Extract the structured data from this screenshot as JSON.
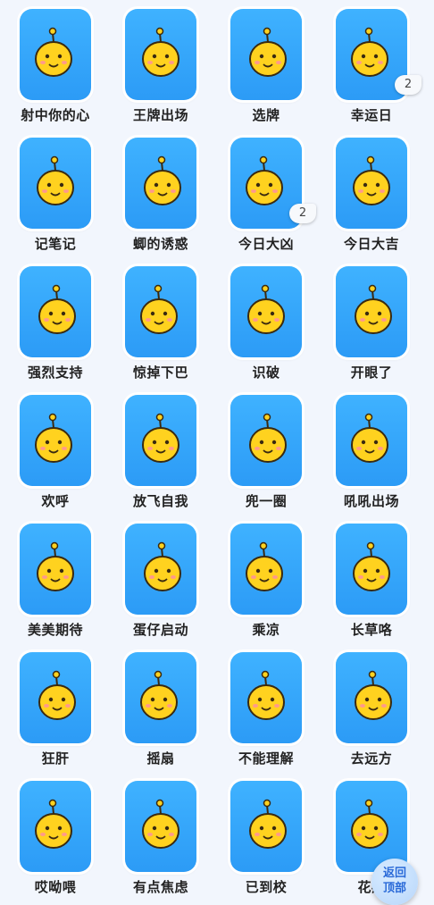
{
  "colors": {
    "card": "#2c9bf6",
    "label": "#222222",
    "face": "#ffd21f",
    "background": "#f2f6fd"
  },
  "stickers": [
    {
      "label": "射中你的心",
      "icon": "bow-heart-icon"
    },
    {
      "label": "王牌出场",
      "icon": "ace-card-icon"
    },
    {
      "label": "选牌",
      "icon": "cards-icon"
    },
    {
      "label": "幸运日",
      "icon": "clover-icon",
      "badge": "2"
    },
    {
      "label": "记笔记",
      "icon": "notebook-icon"
    },
    {
      "label": "蝍的诱惑",
      "icon": "bee-costume-icon"
    },
    {
      "label": "今日大凶",
      "icon": "fortune-slip-icon",
      "badge": "2"
    },
    {
      "label": "今日大吉",
      "icon": "fortune-slip-icon"
    },
    {
      "label": "强烈支持",
      "icon": "pink-cloud-icon"
    },
    {
      "label": "惊掉下巴",
      "icon": "shocked-costume-icon"
    },
    {
      "label": "识破",
      "icon": "detective-icon"
    },
    {
      "label": "开眼了",
      "icon": "glasses-icon"
    },
    {
      "label": "欢呼",
      "icon": "cheer-icon"
    },
    {
      "label": "放飞自我",
      "icon": "kite-icon"
    },
    {
      "label": "兜一圈",
      "icon": "net-icon"
    },
    {
      "label": "吼吼出场",
      "icon": "warrior-icon"
    },
    {
      "label": "美美期待",
      "icon": "white-cloud-icon"
    },
    {
      "label": "蛋仔启动",
      "icon": "launch-icon"
    },
    {
      "label": "乘凉",
      "icon": "leaf-icon"
    },
    {
      "label": "长草咯",
      "icon": "sprout-icon"
    },
    {
      "label": "狂肝",
      "icon": "writing-icon"
    },
    {
      "label": "摇扇",
      "icon": "fan-icon"
    },
    {
      "label": "不能理解",
      "icon": "confused-icon"
    },
    {
      "label": "去远方",
      "icon": "angel-icon"
    },
    {
      "label": "哎呦喂",
      "icon": "sigh-icon"
    },
    {
      "label": "有点焦虑",
      "icon": "anxious-icon"
    },
    {
      "label": "已到校",
      "icon": "school-bag-icon"
    },
    {
      "label": "花痴",
      "icon": "heart-eyes-icon"
    }
  ],
  "back_to_top": {
    "line1": "返回",
    "line2": "顶部"
  }
}
